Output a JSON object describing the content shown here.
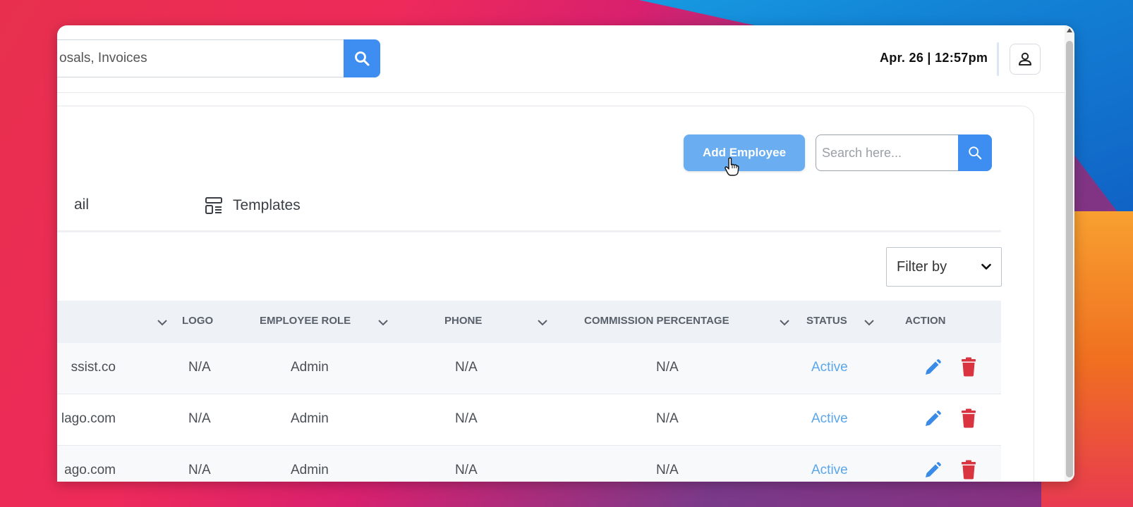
{
  "header": {
    "global_search": {
      "value": "osals, Invoices",
      "placeholder": "Search"
    },
    "datetime": "Apr. 26 | 12:57pm"
  },
  "toolbar": {
    "add_employee_label": "Add Employee",
    "search_placeholder": "Search here..."
  },
  "tabs": [
    {
      "label": "ail"
    },
    {
      "label": "Templates"
    }
  ],
  "filter": {
    "label": "Filter by"
  },
  "table": {
    "columns": [
      "LOGO",
      "EMPLOYEE ROLE",
      "PHONE",
      "COMMISSION PERCENTAGE",
      "STATUS",
      "ACTION"
    ],
    "rows": [
      {
        "email": "ssist.co",
        "logo": "N/A",
        "role": "Admin",
        "phone": "N/A",
        "commission": "N/A",
        "status": "Active"
      },
      {
        "email": "lago.com",
        "logo": "N/A",
        "role": "Admin",
        "phone": "N/A",
        "commission": "N/A",
        "status": "Active"
      },
      {
        "email": "ago.com",
        "logo": "N/A",
        "role": "Admin",
        "phone": "N/A",
        "commission": "N/A",
        "status": "Active"
      }
    ]
  },
  "colors": {
    "accent": "#3d8ef0",
    "add_button": "#6aadf0",
    "status_active": "#5aa6ec",
    "delete": "#d9343f"
  }
}
